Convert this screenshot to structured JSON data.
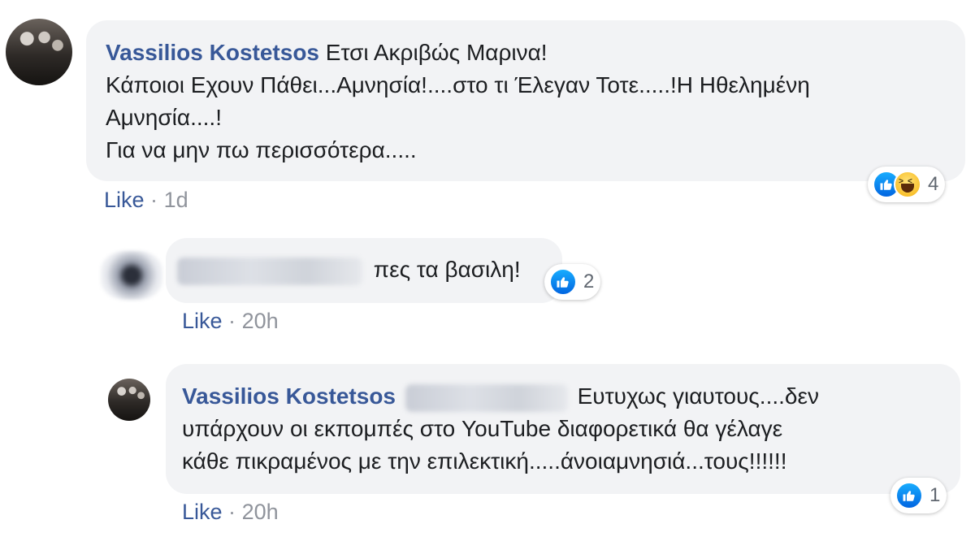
{
  "comments": [
    {
      "author": "Vassilios Kostetsos",
      "lines": [
        "Ετσι Ακριβώς Μαρινα!",
        "Κάποιοι Εχουν Πάθει...Αμνησία!....στο τι Έλεγαν Τοτε.....!Η Ηθελημένη",
        "Αμνησία....!",
        "Για να μην πω περισσότερα....."
      ],
      "reaction_count": "4",
      "reactions": [
        "like-icon",
        "haha-icon"
      ],
      "like_label": "Like",
      "separator": "·",
      "time": "1d"
    },
    {
      "author_redacted": true,
      "text": "πες τα βασιλη!",
      "reaction_count": "2",
      "reactions": [
        "like-icon"
      ],
      "like_label": "Like",
      "separator": "·",
      "time": "20h"
    },
    {
      "author": "Vassilios Kostetsos",
      "mention_redacted": true,
      "lines": [
        "Ευτυχως γιαυτους....δεν",
        "υπάρχουν οι εκπομπές στο YouTube διαφορετικά θα γέλαγε",
        "κάθε πικραμένος με την επιλεκτική.....άνοιαμνησιά...τους!!!!!!"
      ],
      "reaction_count": "1",
      "reactions": [
        "like-icon"
      ],
      "like_label": "Like",
      "separator": "·",
      "time": "20h"
    }
  ],
  "colors": {
    "bubble": "#f2f3f5",
    "author": "#385898",
    "link": "#385898",
    "meta": "#90949c",
    "like_blue": "#1877f2",
    "haha_yellow": "#f9c12e"
  }
}
